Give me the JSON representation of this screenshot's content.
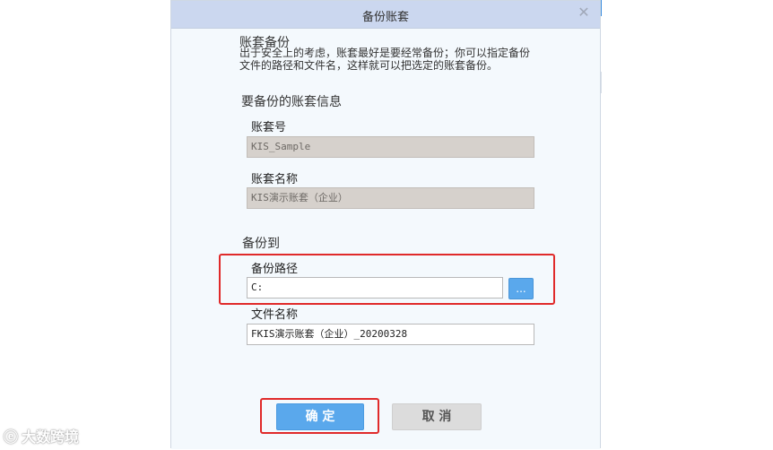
{
  "dialog": {
    "title": "备份账套",
    "close_icon": "close-icon"
  },
  "intro": {
    "heading": "账套备份",
    "line1": "出于安全上的考虑，账套最好是要经常备份；你可以指定备份",
    "line2": "文件的路径和文件名，这样就可以把选定的账套备份。"
  },
  "account_info": {
    "heading": "要备份的账套信息",
    "id_label": "账套号",
    "id_value": "KIS_Sample",
    "name_label": "账套名称",
    "name_value": "KIS演示账套（企业）"
  },
  "backup_to": {
    "heading": "备份到",
    "path_label": "备份路径",
    "path_value": "C:",
    "browse_label": "...",
    "file_label": "文件名称",
    "file_value": "FKIS演示账套（企业）_20200328"
  },
  "buttons": {
    "ok": "确 定",
    "cancel": "取 消"
  },
  "watermark": {
    "text": "大数跨境"
  },
  "colors": {
    "titlebar": "#cbd7ef",
    "primary_button": "#5aa8ec",
    "highlight": "#e02a2a"
  }
}
